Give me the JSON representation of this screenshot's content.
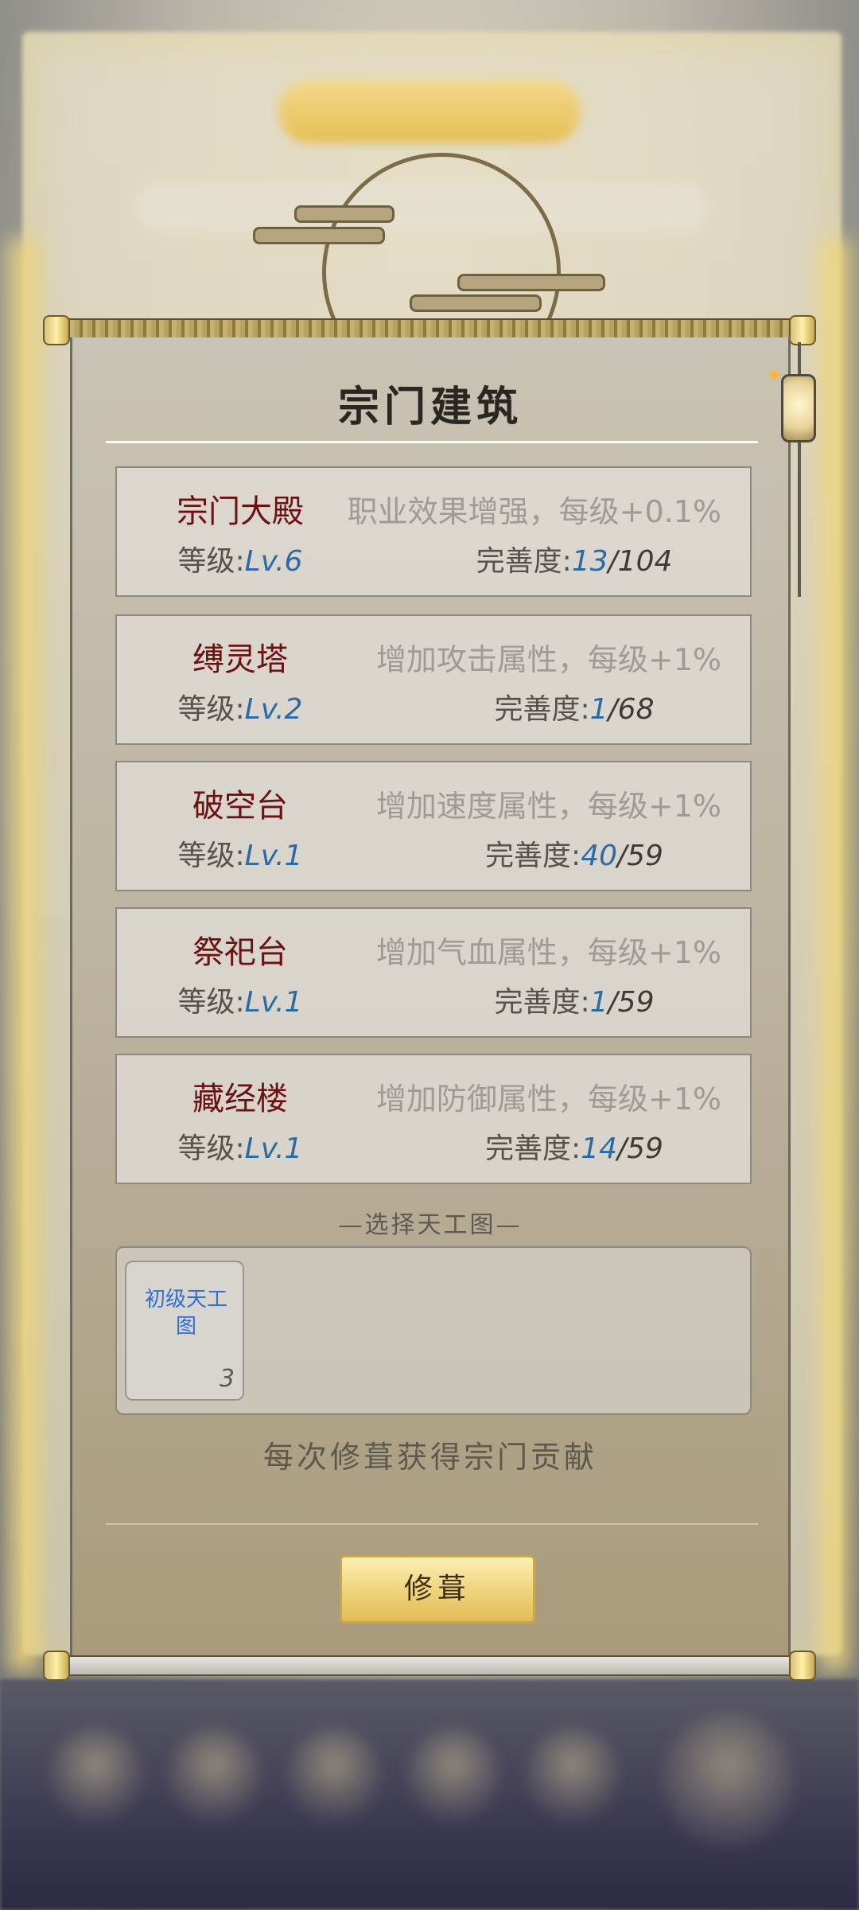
{
  "panel": {
    "title": "宗门建筑",
    "buildings": [
      {
        "name": "宗门大殿",
        "desc": "职业效果增强，每级+0.1%",
        "level_label": "等级:",
        "level": "Lv.6",
        "completeness_label": "完善度:",
        "completeness_current": "13",
        "completeness_rest": "/104"
      },
      {
        "name": "缚灵塔",
        "desc": "增加攻击属性，每级+1%",
        "level_label": "等级:",
        "level": "Lv.2",
        "completeness_label": "完善度:",
        "completeness_current": "1",
        "completeness_rest": "/68"
      },
      {
        "name": "破空台",
        "desc": "增加速度属性，每级+1%",
        "level_label": "等级:",
        "level": "Lv.1",
        "completeness_label": "完善度:",
        "completeness_current": "40",
        "completeness_rest": "/59"
      },
      {
        "name": "祭祀台",
        "desc": "增加气血属性，每级+1%",
        "level_label": "等级:",
        "level": "Lv.1",
        "completeness_label": "完善度:",
        "completeness_current": "1",
        "completeness_rest": "/59"
      },
      {
        "name": "藏经楼",
        "desc": "增加防御属性，每级+1%",
        "level_label": "等级:",
        "level": "Lv.1",
        "completeness_label": "完善度:",
        "completeness_current": "14",
        "completeness_rest": "/59"
      }
    ],
    "picker_title": "—选择天工图—",
    "item": {
      "name": "初级天工图",
      "count": "3"
    },
    "note": "每次修葺获得宗门贡献",
    "repair_button": "修葺"
  },
  "colors": {
    "name_red": "#6b1111",
    "value_blue": "#2a6aa5",
    "item_blue": "#2f6fd6",
    "button_gold": "#eed27a"
  },
  "icons": [
    "lantern-icon",
    "spark-icon",
    "moon-cloud-decoration"
  ]
}
